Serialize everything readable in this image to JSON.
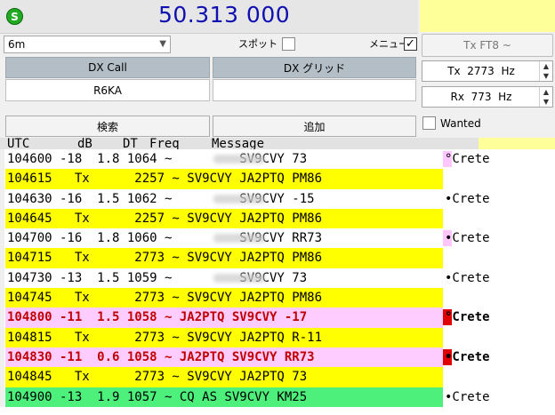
{
  "header": {
    "status_letter": "S",
    "frequency": "50.313 000"
  },
  "controls": {
    "band": "6m",
    "spot_label": "スポット",
    "menu_label": "メニュー",
    "menu_checked": "✓",
    "tx_mode_label": "Tx FT8 ~",
    "dx_call_header": "DX Call",
    "dx_grid_header": "DX グリッド",
    "dx_call_value": "R6KA",
    "dx_grid_value": "",
    "tx_freq": "Tx  2773  Hz",
    "rx_freq": "Rx  773  Hz",
    "wanted_label": "Wanted",
    "search_label": "検索",
    "add_label": "追加"
  },
  "table": {
    "columns": [
      "UTC",
      "dB",
      "DT",
      "Freq",
      "Message"
    ],
    "rows": [
      {
        "text": "104600 -18  1.8 1064 ~         SV9CVY 73",
        "bg": "white",
        "blur": true,
        "marker": "pink",
        "loc": "°Crete",
        "style": ""
      },
      {
        "text": "104615   Tx      2257 ~ SV9CVY JA2PTQ PM86",
        "bg": "yellow",
        "blur": false,
        "marker": "",
        "loc": "",
        "style": ""
      },
      {
        "text": "104630 -16  1.5 1062 ~         SV9CVY -15",
        "bg": "white",
        "blur": true,
        "marker": "",
        "loc": "•Crete",
        "style": ""
      },
      {
        "text": "104645   Tx      2257 ~ SV9CVY JA2PTQ PM86",
        "bg": "yellow",
        "blur": false,
        "marker": "",
        "loc": "",
        "style": ""
      },
      {
        "text": "104700 -16  1.8 1060 ~         SV9CVY RR73",
        "bg": "white",
        "blur": true,
        "marker": "pink",
        "loc": "•Crete",
        "style": ""
      },
      {
        "text": "104715   Tx      2773 ~ SV9CVY JA2PTQ PM86",
        "bg": "yellow",
        "blur": false,
        "marker": "",
        "loc": "",
        "style": ""
      },
      {
        "text": "104730 -13  1.5 1059 ~         SV9CVY 73",
        "bg": "white",
        "blur": true,
        "marker": "",
        "loc": "•Crete",
        "style": ""
      },
      {
        "text": "104745   Tx      2773 ~ SV9CVY JA2PTQ PM86",
        "bg": "yellow",
        "blur": false,
        "marker": "",
        "loc": "",
        "style": ""
      },
      {
        "text": "104800 -11  1.5 1058 ~ JA2PTQ SV9CVY -17",
        "bg": "pink",
        "blur": false,
        "marker": "red",
        "loc": "°Crete",
        "style": "bold"
      },
      {
        "text": "104815   Tx      2773 ~ SV9CVY JA2PTQ R-11",
        "bg": "yellow",
        "blur": false,
        "marker": "",
        "loc": "",
        "style": ""
      },
      {
        "text": "104830 -11  0.6 1058 ~ JA2PTQ SV9CVY RR73",
        "bg": "pink",
        "blur": false,
        "marker": "red",
        "loc": "•Crete",
        "style": "bold"
      },
      {
        "text": "104845   Tx      2773 ~ SV9CVY JA2PTQ 73",
        "bg": "yellow",
        "blur": false,
        "marker": "",
        "loc": "",
        "style": ""
      },
      {
        "text": "104900 -13  1.9 1057 ~ CQ AS SV9CVY KM25",
        "bg": "green",
        "blur": false,
        "marker": "",
        "loc": "•Crete",
        "style": ""
      }
    ]
  }
}
